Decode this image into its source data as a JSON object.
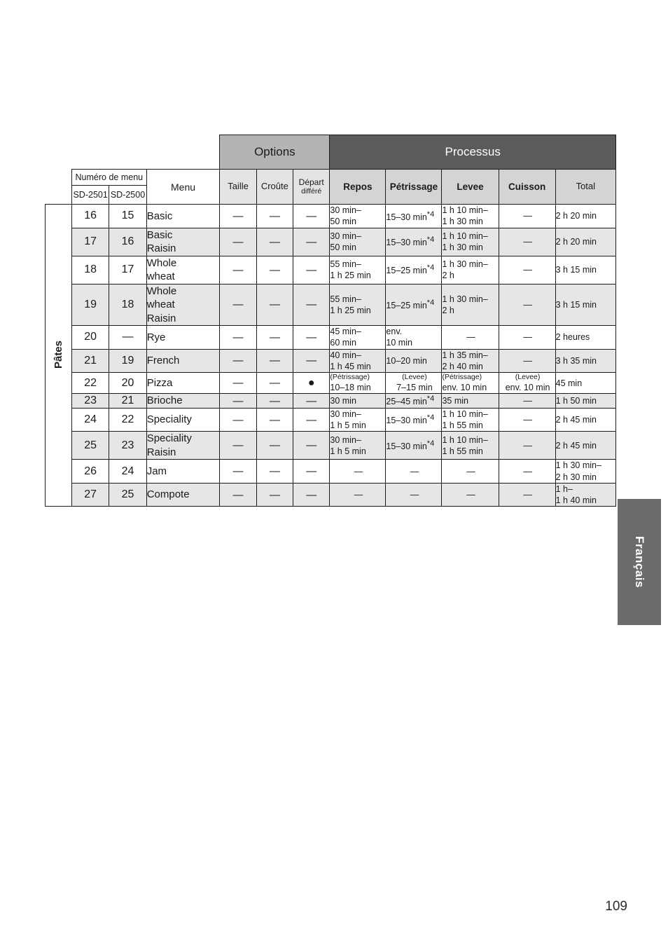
{
  "page": {
    "number": "109",
    "language_tab": "Français"
  },
  "table": {
    "banners": {
      "options": "Options",
      "processus": "Processus"
    },
    "headers": {
      "menu_number_title": "Numéro de menu",
      "model_left": "SD-2501",
      "model_right": "SD-2500",
      "menu": "Menu",
      "taille": "Taille",
      "croute": "Croûte",
      "depart_line1": "Départ",
      "depart_line2": "différé",
      "repos": "Repos",
      "petrissage": "Pétrissage",
      "levee": "Levee",
      "cuisson": "Cuisson",
      "total": "Total"
    },
    "category_label": "Pâtes",
    "dash": "—",
    "dot": "●",
    "rows": [
      {
        "shaded": false,
        "sd2501": "16",
        "sd2500": "15",
        "menu": "Basic",
        "taille": "—",
        "croute": "—",
        "depart": "—",
        "repos_l1": "30 min–",
        "repos_l2": "50 min",
        "petrissage": "15–30 min",
        "petrissage_note": "*4",
        "levee_l1": "1 h 10 min–",
        "levee_l2": "1 h 30 min",
        "cuisson": "—",
        "total_l1": "2 h 20 min",
        "total_l2": ""
      },
      {
        "shaded": true,
        "sd2501": "17",
        "sd2500": "16",
        "menu": "Basic\nRaisin",
        "taille": "—",
        "croute": "—",
        "depart": "—",
        "repos_l1": "30 min–",
        "repos_l2": "50 min",
        "petrissage": "15–30 min",
        "petrissage_note": "*4",
        "levee_l1": "1 h 10 min–",
        "levee_l2": "1 h 30 min",
        "cuisson": "—",
        "total_l1": "2 h 20 min",
        "total_l2": ""
      },
      {
        "shaded": false,
        "sd2501": "18",
        "sd2500": "17",
        "menu": "Whole\nwheat",
        "taille": "—",
        "croute": "—",
        "depart": "—",
        "repos_l1": "55 min–",
        "repos_l2": "1 h 25 min",
        "petrissage": "15–25 min",
        "petrissage_note": "*4",
        "levee_l1": "1 h 30 min–",
        "levee_l2": "2 h",
        "cuisson": "—",
        "total_l1": "3 h 15 min",
        "total_l2": ""
      },
      {
        "shaded": true,
        "sd2501": "19",
        "sd2500": "18",
        "menu": "Whole\nwheat\nRaisin",
        "taille": "—",
        "croute": "—",
        "depart": "—",
        "repos_l1": "55 min–",
        "repos_l2": "1 h 25 min",
        "petrissage": "15–25 min",
        "petrissage_note": "*4",
        "levee_l1": "1 h 30 min–",
        "levee_l2": "2 h",
        "cuisson": "—",
        "total_l1": "3 h 15 min",
        "total_l2": ""
      },
      {
        "shaded": false,
        "sd2501": "20",
        "sd2500": "—",
        "menu": "Rye",
        "taille": "—",
        "croute": "—",
        "depart": "—",
        "repos_l1": "45 min–",
        "repos_l2": "60 min",
        "petrissage": "env.\n10 min",
        "petrissage_note": "",
        "levee_l1": "—",
        "levee_l2": "",
        "cuisson": "—",
        "total_l1": "2 heures",
        "total_l2": ""
      },
      {
        "shaded": true,
        "sd2501": "21",
        "sd2500": "19",
        "menu": "French",
        "taille": "—",
        "croute": "—",
        "depart": "—",
        "repos_l1": "40 min–",
        "repos_l2": "1 h 45 min",
        "petrissage": "10–20 min",
        "petrissage_note": "",
        "levee_l1": "1 h 35 min–",
        "levee_l2": "2 h 40 min",
        "cuisson": "—",
        "total_l1": "3 h 35 min",
        "total_l2": ""
      },
      {
        "shaded": false,
        "sd2501": "22",
        "sd2500": "20",
        "menu": "Pizza",
        "taille": "—",
        "croute": "—",
        "depart": "●",
        "repos_paren": "(Pétrissage)",
        "repos_l1": "10–18 min",
        "repos_l2": "",
        "petrissage_paren": "(Levee)",
        "petrissage": "7–15 min",
        "petrissage_note": "",
        "levee_paren": "(Pétrissage)",
        "levee_l1": "env. 10 min",
        "levee_l2": "",
        "cuisson_paren": "(Levee)",
        "cuisson": "env. 10 min",
        "total_l1": "45 min",
        "total_l2": ""
      },
      {
        "shaded": true,
        "sd2501": "23",
        "sd2500": "21",
        "menu": "Brioche",
        "taille": "—",
        "croute": "—",
        "depart": "—",
        "repos_l1": "30 min",
        "repos_l2": "",
        "petrissage": "25–45 min",
        "petrissage_note": "*4",
        "levee_l1": "35 min",
        "levee_l2": "",
        "cuisson": "—",
        "total_l1": "1 h 50 min",
        "total_l2": ""
      },
      {
        "shaded": false,
        "sd2501": "24",
        "sd2500": "22",
        "menu": "Speciality",
        "taille": "—",
        "croute": "—",
        "depart": "—",
        "repos_l1": "30 min–",
        "repos_l2": "1 h 5 min",
        "petrissage": "15–30 min",
        "petrissage_note": "*4",
        "levee_l1": "1 h 10 min–",
        "levee_l2": "1 h 55 min",
        "cuisson": "—",
        "total_l1": "2 h 45 min",
        "total_l2": ""
      },
      {
        "shaded": true,
        "sd2501": "25",
        "sd2500": "23",
        "menu": "Speciality\nRaisin",
        "taille": "—",
        "croute": "—",
        "depart": "—",
        "repos_l1": "30 min–",
        "repos_l2": "1 h 5 min",
        "petrissage": "15–30 min",
        "petrissage_note": "*4",
        "levee_l1": "1 h 10 min–",
        "levee_l2": "1 h 55 min",
        "cuisson": "—",
        "total_l1": "2 h 45 min",
        "total_l2": ""
      },
      {
        "shaded": false,
        "sd2501": "26",
        "sd2500": "24",
        "menu": "Jam",
        "taille": "—",
        "croute": "—",
        "depart": "—",
        "repos_l1": "—",
        "repos_l2": "",
        "petrissage": "—",
        "petrissage_note": "",
        "levee_l1": "—",
        "levee_l2": "",
        "cuisson": "—",
        "total_l1": "1 h 30 min–",
        "total_l2": "2 h 30 min"
      },
      {
        "shaded": true,
        "sd2501": "27",
        "sd2500": "25",
        "menu": "Compote",
        "taille": "—",
        "croute": "—",
        "depart": "—",
        "repos_l1": "—",
        "repos_l2": "",
        "petrissage": "—",
        "petrissage_note": "",
        "levee_l1": "—",
        "levee_l2": "",
        "cuisson": "—",
        "total_l1": "1 h–",
        "total_l2": "1 h 40 min"
      }
    ]
  },
  "colors": {
    "banner_options_bg": "#b4b4b4",
    "banner_processus_bg": "#5b5b5b",
    "header_bg": "#d4d4d4",
    "row_shade_bg": "#e6e6e6",
    "tab_bg": "#6b6b6b",
    "border": "#1a1a1a"
  }
}
